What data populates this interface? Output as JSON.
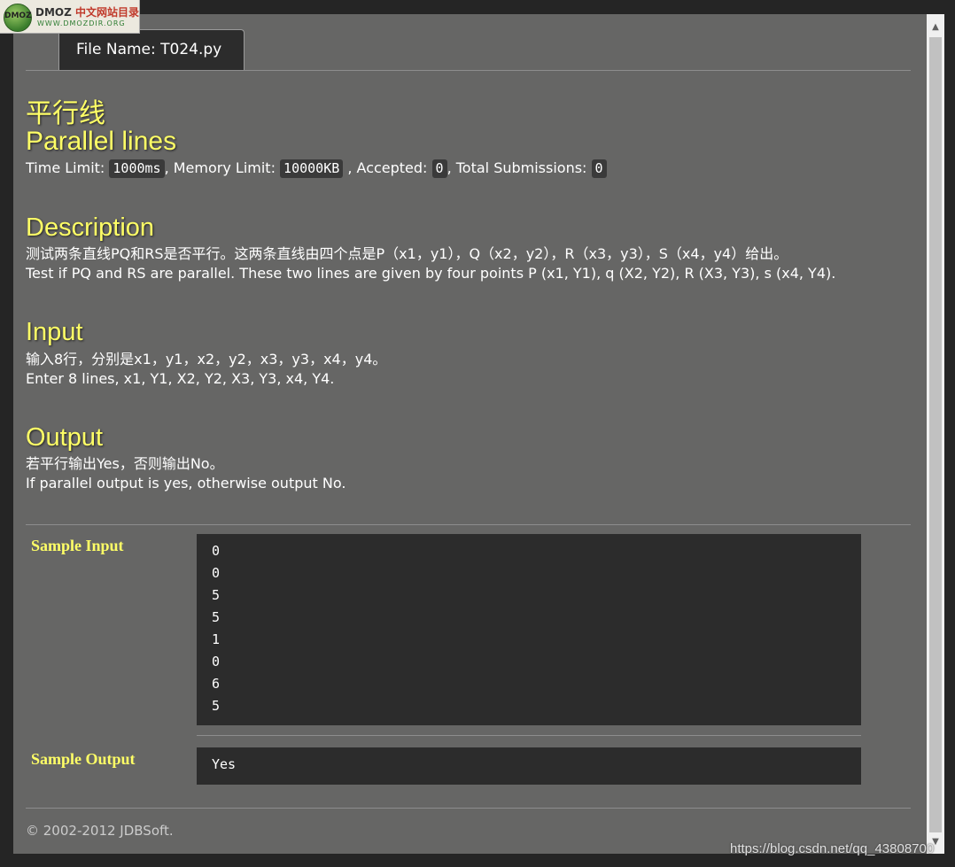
{
  "logo": {
    "globe_text": "DMOZ",
    "title_en": "DMOZ",
    "title_cn": "中文网站目录",
    "subtitle": "WWW.DMOZDIR.ORG"
  },
  "tab": {
    "file_name": "File Name:  T024.py"
  },
  "problem": {
    "title_cn": "平行线",
    "title_en": "Parallel lines",
    "time_limit_label": "Time Limit: ",
    "time_limit": "1000ms",
    "memory_limit_label": ", Memory Limit: ",
    "memory_limit": "10000KB",
    "accepted_label": " , Accepted: ",
    "accepted": "0",
    "total_label": ", Total Submissions: ",
    "total": "0"
  },
  "sections": {
    "description": {
      "heading": "Description",
      "line_cn": "测试两条直线PQ和RS是否平行。这两条直线由四个点是P（x1，y1），Q（x2，y2），R（x3，y3），S（x4，y4）给出。",
      "line_en": "Test if PQ and RS are parallel. These two lines are given by four points P (x1, Y1), q (X2, Y2), R (X3, Y3), s (x4, Y4)."
    },
    "input": {
      "heading": "Input",
      "line_cn": "输入8行，分别是x1，y1，x2，y2，x3，y3，x4，y4。",
      "line_en": "Enter 8 lines, x1, Y1, X2, Y2, X3, Y3, x4, Y4."
    },
    "output": {
      "heading": "Output",
      "line_cn": "若平行输出Yes，否则输出No。",
      "line_en": "If parallel output is yes, otherwise output No."
    }
  },
  "sample": {
    "input_label": "Sample Input",
    "input_lines": [
      "0",
      "0",
      "5",
      "5",
      "1",
      "0",
      "6",
      "5"
    ],
    "output_label": "Sample Output",
    "output_lines": [
      "Yes"
    ]
  },
  "footer": {
    "copyright": "© 2002-2012  JDBSoft."
  },
  "watermark": "https://blog.csdn.net/qq_43808700",
  "scrollbar": {
    "up_icon": "▲",
    "down_icon": "▼"
  },
  "colors": {
    "background": "#666665",
    "heading": "#ffff66",
    "code_box": "#2c2c2c"
  }
}
